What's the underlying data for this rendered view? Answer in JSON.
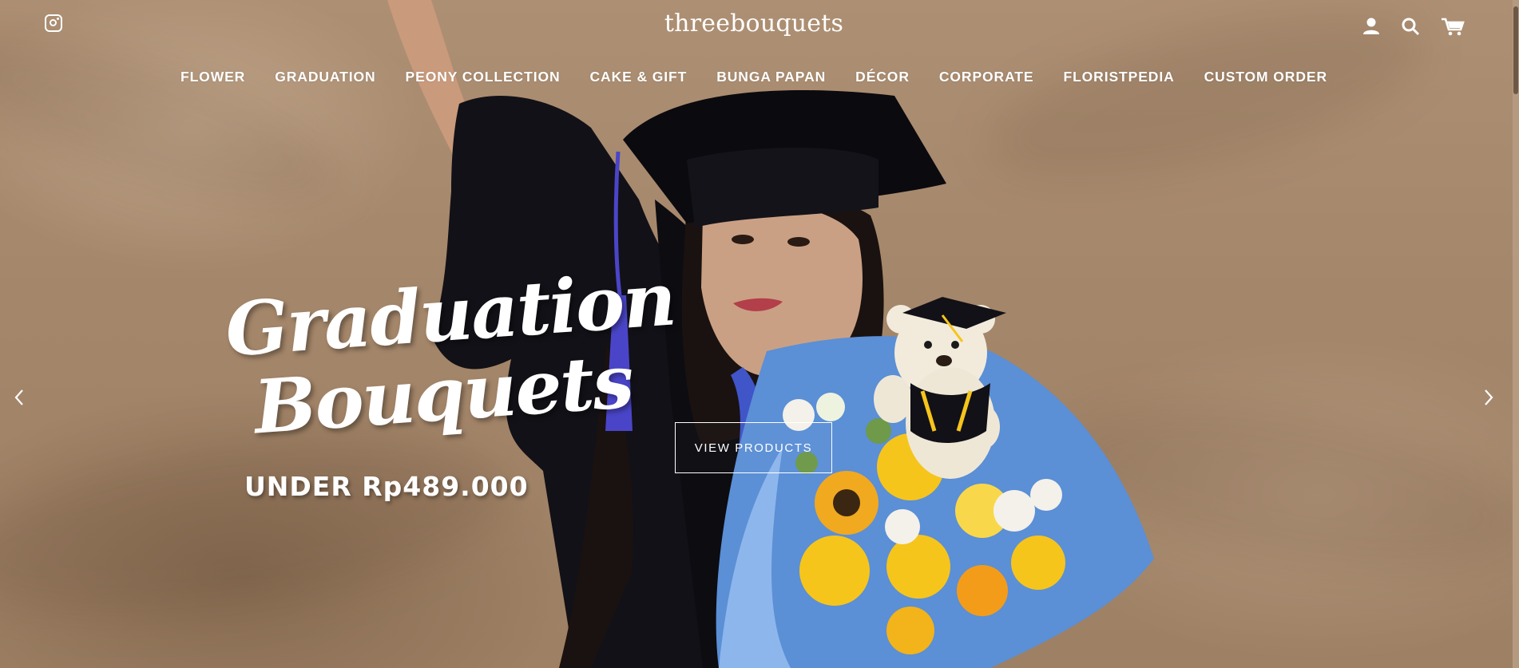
{
  "brand": {
    "name": "threebouquets"
  },
  "header": {
    "instagram_icon": "instagram-icon",
    "account_icon": "account-icon",
    "search_icon": "search-icon",
    "cart_icon": "cart-icon"
  },
  "nav": {
    "items": [
      {
        "label": "FLOWER"
      },
      {
        "label": "GRADUATION"
      },
      {
        "label": "PEONY COLLECTION"
      },
      {
        "label": "CAKE & GIFT"
      },
      {
        "label": "BUNGA PAPAN"
      },
      {
        "label": "DÉCOR"
      },
      {
        "label": "CORPORATE"
      },
      {
        "label": "FLORISTPEDIA"
      },
      {
        "label": "CUSTOM ORDER"
      }
    ]
  },
  "hero": {
    "headline_line1": "Graduation",
    "headline_line2": "Bouquets",
    "price_text": "UNDER Rp489.000",
    "cta_label": "VIEW PRODUCTS",
    "prev_icon": "chevron-left-icon",
    "next_icon": "chevron-right-icon"
  },
  "colors": {
    "background": "#a88a6e",
    "text": "#ffffff",
    "gown": "#111016",
    "tassel": "#4a45c8",
    "wrap": "#5b8fd6",
    "flower_yellow": "#f6c51c"
  }
}
